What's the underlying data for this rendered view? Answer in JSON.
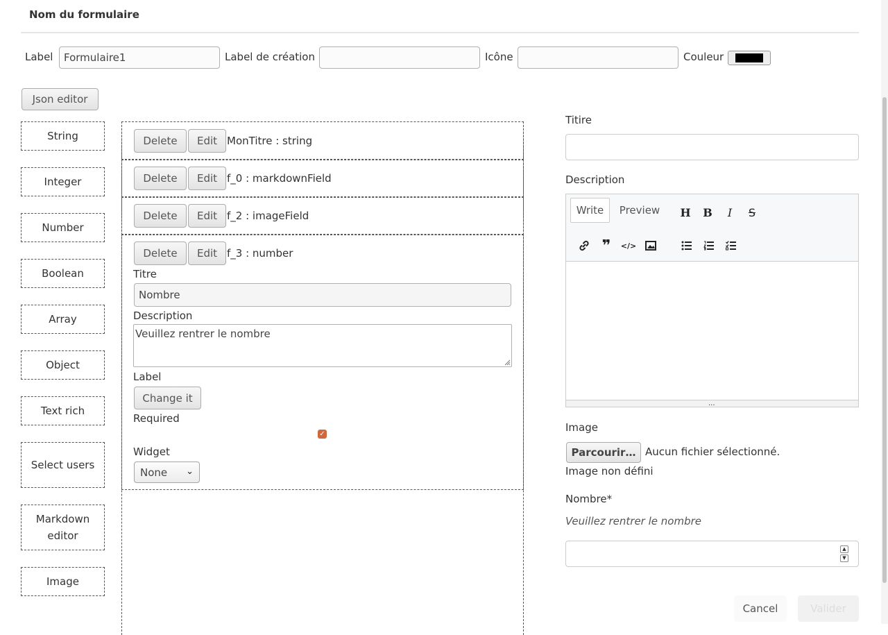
{
  "header": {
    "title": "Nom du formulaire"
  },
  "form_props": {
    "label_label": "Label",
    "label_value": "Formulaire1",
    "creation_label": "Label de création",
    "creation_value": "",
    "icon_label": "Icône",
    "icon_value": "",
    "color_label": "Couleur",
    "color_value": "#000000"
  },
  "json_editor_label": "Json editor",
  "palette": {
    "string": "String",
    "integer": "Integer",
    "number": "Number",
    "boolean": "Boolean",
    "array": "Array",
    "object": "Object",
    "text_rich": "Text rich",
    "select_users": "Select users",
    "markdown_editor": "Markdown editor",
    "image": "Image"
  },
  "canvas": {
    "delete_label": "Delete",
    "edit_label": "Edit",
    "fields": [
      "MonTitre : string",
      "f_0 : markdownField",
      "f_2 : imageField",
      "f_3 : number"
    ],
    "editor": {
      "titre_label": "Titre",
      "titre_value": "Nombre",
      "description_label": "Description",
      "description_value": "Veuillez rentrer le nombre",
      "label_label": "Label",
      "change_label": "Change it",
      "required_label": "Required",
      "required_checked": true,
      "widget_label": "Widget",
      "widget_value": "None"
    }
  },
  "preview": {
    "titire_label": "Titire",
    "titire_value": "",
    "description_label": "Description",
    "md_tabs": {
      "write": "Write",
      "preview": "Preview"
    },
    "md_toolbar_icons": [
      "heading-icon",
      "bold-icon",
      "italic-icon",
      "strikethrough-icon",
      "link-icon",
      "quote-icon",
      "code-icon",
      "image-icon",
      "bulleted-list-icon",
      "numbered-list-icon",
      "task-list-icon"
    ],
    "md_resize_handle": "...",
    "image_label": "Image",
    "browse_label": "Parcourir…",
    "no_file_label": "Aucun fichier sélectionné.",
    "image_status": "Image non défini",
    "nombre_label": "Nombre*",
    "nombre_help": "Veuillez rentrer le nombre",
    "nombre_value": "",
    "cancel_label": "Cancel",
    "validate_label": "Valider"
  },
  "colors": {
    "accent": "#d2673c",
    "dashed_border": "#555555",
    "muted_button": "#f1f1f1"
  }
}
